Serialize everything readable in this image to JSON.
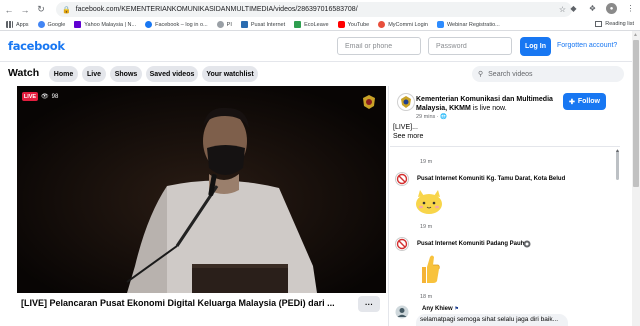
{
  "browser": {
    "url": "facebook.com/KEMENTERIANKOMUNIKASIDANMULTIMEDIA/videos/286397016583708/",
    "bookmarks": [
      {
        "label": "Apps",
        "color": "#5f6368"
      },
      {
        "label": "Google",
        "color": "#4285f4"
      },
      {
        "label": "Yahoo Malaysia | N...",
        "color": "#6001d2"
      },
      {
        "label": "Facebook – log in o...",
        "color": "#1877f2"
      },
      {
        "label": "PI",
        "color": "#9aa0a6"
      },
      {
        "label": "Pusat Internet",
        "color": "#2b6cb0"
      },
      {
        "label": "EcoLeave",
        "color": "#2e9e4f"
      },
      {
        "label": "YouTube",
        "color": "#ff0000"
      },
      {
        "label": "MyCommi Login",
        "color": "#e84f3c"
      },
      {
        "label": "Webinar Registratio...",
        "color": "#2d8cff"
      }
    ],
    "reading_list": "Reading list"
  },
  "fb": {
    "logo": "facebook",
    "email_placeholder": "Email or phone",
    "password_placeholder": "Password",
    "login": "Log In",
    "forgot": "Forgotten account?"
  },
  "watch": {
    "title": "Watch",
    "tabs": [
      "Home",
      "Live",
      "Shows",
      "Saved videos",
      "Your watchlist"
    ],
    "search_placeholder": "Search videos"
  },
  "video": {
    "live": "LIVE",
    "viewers": "98",
    "title": "[LIVE] Pelancaran Pusat Ekonomi Digital Keluarga Malaysia (PEDi) dari ...",
    "more": "···"
  },
  "page": {
    "name": "Kementerian Komunikasi dan Multimedia Malaysia, KKMM",
    "status": " is live now.",
    "meta": "29 mins · 🌐",
    "follow": "Follow",
    "desc_line1": "[LIVE]...",
    "desc_line2": "See more"
  },
  "comments": [
    {
      "time": "19 m"
    },
    {
      "name": "Pusat Internet Komuniti Kg. Tamu Darat, Kota Belud",
      "reaction": "cat-sticker",
      "time": "19 m"
    },
    {
      "name": "Pusat Internet Komuniti Padang Pauh",
      "reaction": "thumbs-up-sticker",
      "time": "18 m"
    },
    {
      "name": "Any Khiew",
      "text": "selamatpagi semoga sihat selalu jaga diri baik..."
    }
  ],
  "colors": {
    "brand": "#1877f2",
    "live": "#e41e3f"
  }
}
